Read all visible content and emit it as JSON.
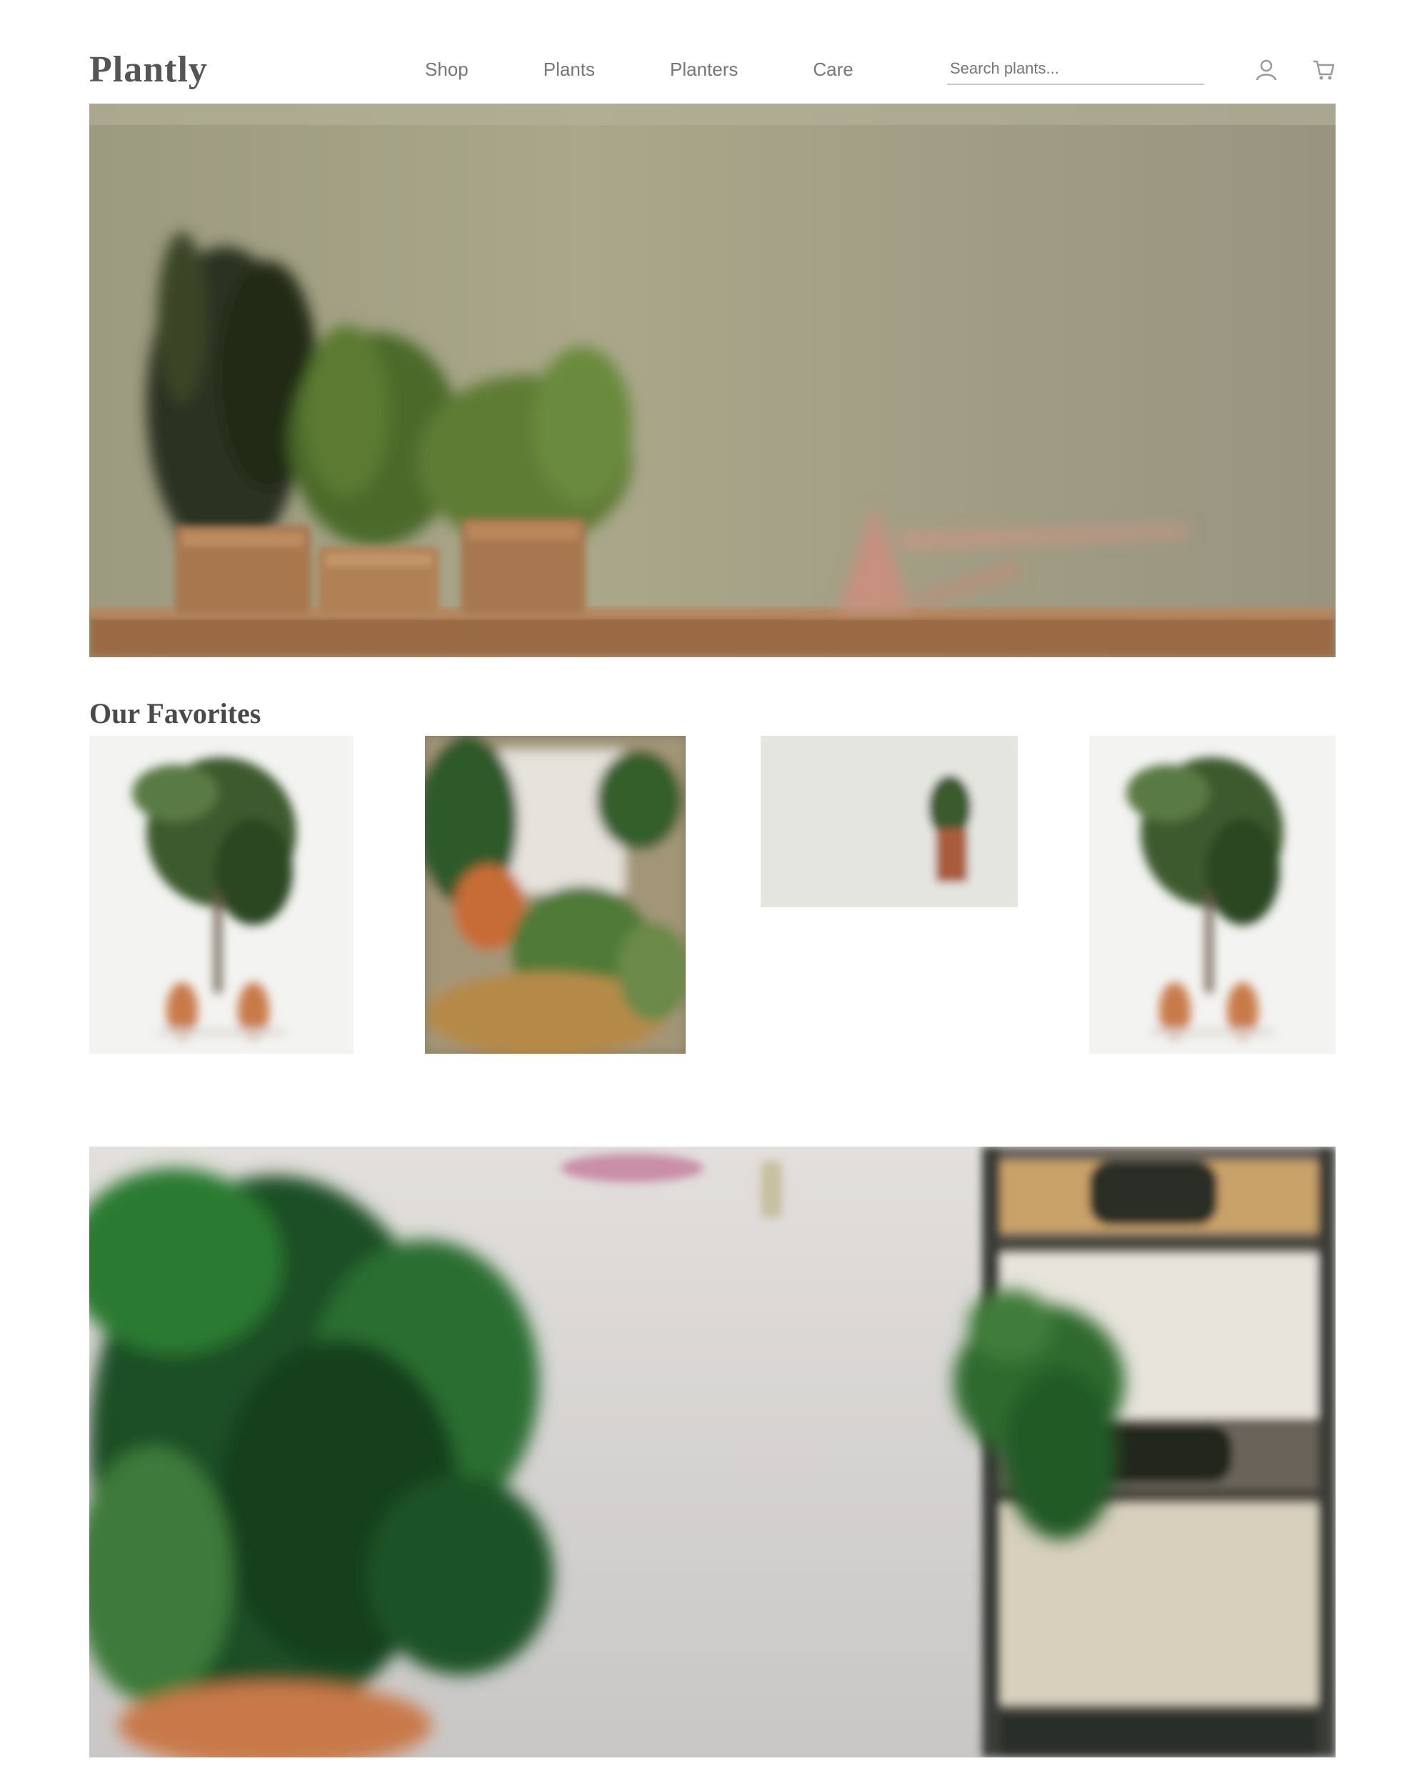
{
  "header": {
    "logo": "Plantly",
    "nav": [
      {
        "label": "Shop"
      },
      {
        "label": "Plants"
      },
      {
        "label": "Planters"
      },
      {
        "label": "Care"
      }
    ],
    "search": {
      "placeholder": "Search plants..."
    },
    "icons": [
      "user-icon",
      "cart-icon"
    ]
  },
  "hero": {
    "image": "potted-plants-on-shelf"
  },
  "featured": {
    "title": "Our Favorites",
    "items": [
      {
        "image": "fiddle-leaf-plant"
      },
      {
        "image": "indoor-plant-collection"
      },
      {
        "image": "small-potted-plant"
      },
      {
        "image": "fiddle-leaf-plant"
      }
    ]
  },
  "banner": {
    "image": "monstera-room-shelves"
  },
  "colors": {
    "accent": "#2f5a2a",
    "wall_olive": "#a8a486",
    "terracotta": "#b86a3c"
  }
}
